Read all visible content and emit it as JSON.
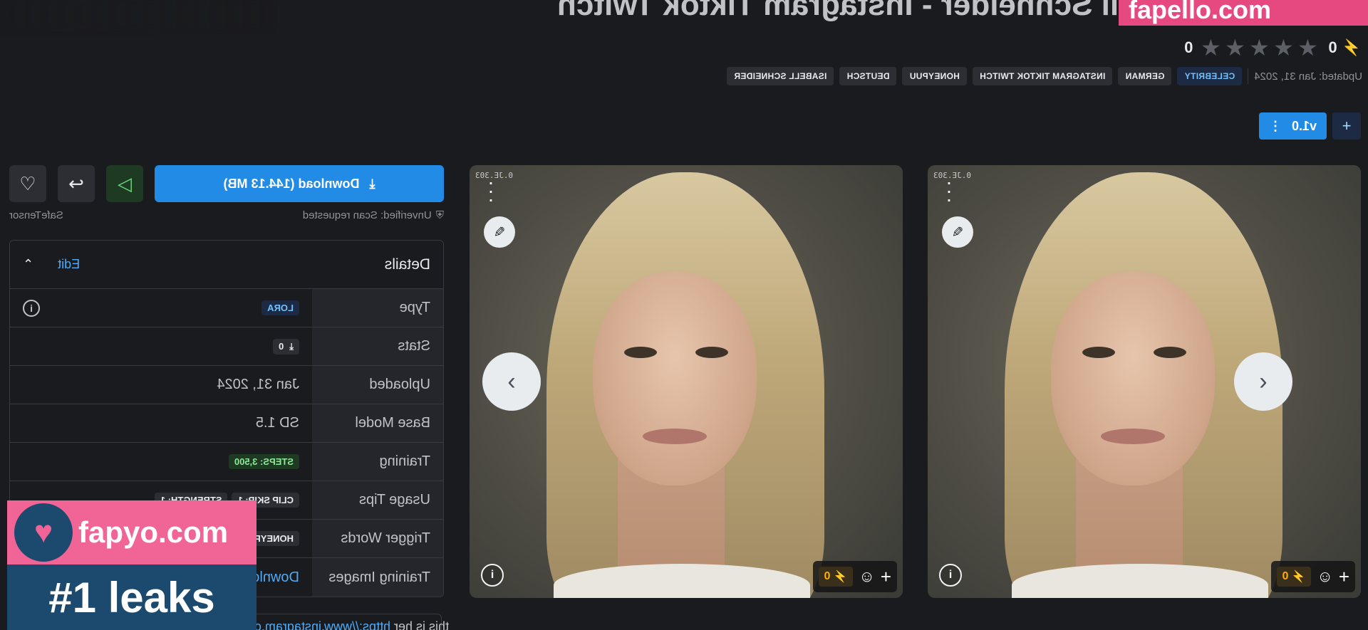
{
  "header": {
    "title": "HQ LoRa - Isabell Schneider - Instagram Tiktok Twitch",
    "bolt_count": "0",
    "rating_count": "0",
    "updated": "Updated: Jan 31, 2024",
    "category": "CELEBRITY",
    "tags": [
      "GERMAN",
      "INSTAGRAM TIKTOK TWITCH",
      "HONEYPUU",
      "DEUTSCH",
      "ISABELL SCHNEIDER"
    ]
  },
  "version": {
    "label": "v1.0",
    "plus": "+",
    "menu": "⋮"
  },
  "cards": [
    {
      "meta": "0.JE.303",
      "reaction_count": "0",
      "info": "i"
    },
    {
      "meta": "0.JE.303",
      "reaction_count": "0",
      "info": "i"
    }
  ],
  "actions": {
    "download_label": "Download (144.13 MB)",
    "scan_status": "Unverified: Scan requested",
    "file_format": "SafeTensor"
  },
  "details": {
    "heading": "Details",
    "edit_label": "Edit",
    "rows": [
      {
        "key": "Type",
        "value": "LORA"
      },
      {
        "key": "Stats",
        "value": "0"
      },
      {
        "key": "Uploaded",
        "value": "Jan 31, 2024"
      },
      {
        "key": "Base Model",
        "value": "SD 1.5"
      },
      {
        "key": "Training",
        "value": "STEPS: 3,500"
      },
      {
        "key": "Usage Tips",
        "value": "CLIP SKIP: 1",
        "value2": "STRENGTH: 1"
      },
      {
        "key": "Trigger Words",
        "value": "HONEYPUU"
      },
      {
        "key": "Training Images",
        "value": "Download"
      }
    ]
  },
  "description": {
    "prefix": "this is her ",
    "link": "https://www.instagram.com/honeypuu"
  },
  "watermark": {
    "top": "fapello.com",
    "domain": "fapyo.com",
    "slogan": "#1 leaks"
  },
  "colors": {
    "accent": "#228be6",
    "background": "#1a1b1e",
    "watermark_pink": "#f06595",
    "watermark_blue": "#1c4a6e"
  }
}
